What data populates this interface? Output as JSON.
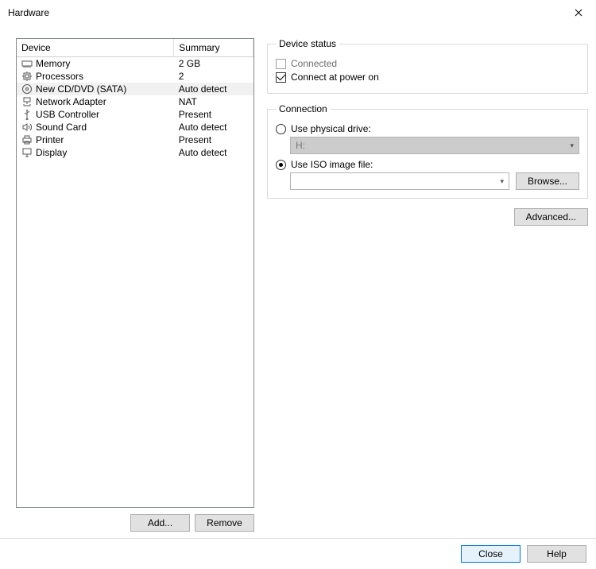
{
  "window": {
    "title": "Hardware",
    "close_label": "Close window"
  },
  "device_table": {
    "headers": {
      "device": "Device",
      "summary": "Summary"
    },
    "rows": [
      {
        "icon": "memory-icon",
        "name": "Memory",
        "summary": "2 GB",
        "selected": false
      },
      {
        "icon": "cpu-icon",
        "name": "Processors",
        "summary": "2",
        "selected": false
      },
      {
        "icon": "disc-icon",
        "name": "New CD/DVD (SATA)",
        "summary": "Auto detect",
        "selected": true
      },
      {
        "icon": "network-icon",
        "name": "Network Adapter",
        "summary": "NAT",
        "selected": false
      },
      {
        "icon": "usb-icon",
        "name": "USB Controller",
        "summary": "Present",
        "selected": false
      },
      {
        "icon": "sound-icon",
        "name": "Sound Card",
        "summary": "Auto detect",
        "selected": false
      },
      {
        "icon": "printer-icon",
        "name": "Printer",
        "summary": "Present",
        "selected": false
      },
      {
        "icon": "display-icon",
        "name": "Display",
        "summary": "Auto detect",
        "selected": false
      }
    ]
  },
  "buttons": {
    "add": "Add...",
    "remove": "Remove",
    "browse": "Browse...",
    "advanced": "Advanced...",
    "close": "Close",
    "help": "Help"
  },
  "device_status": {
    "legend": "Device status",
    "connected": "Connected",
    "connect_power_on": "Connect at power on"
  },
  "connection": {
    "legend": "Connection",
    "physical": "Use physical drive:",
    "physical_value": "H:",
    "iso": "Use ISO image file:",
    "iso_value": ""
  }
}
